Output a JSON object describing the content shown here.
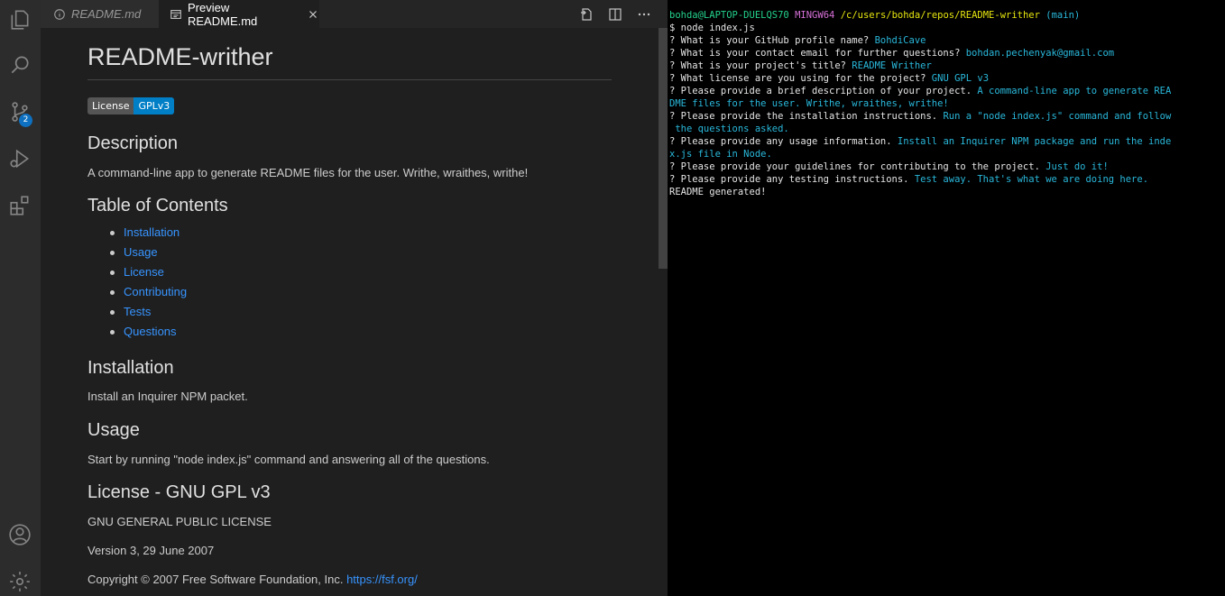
{
  "tabs": [
    {
      "label": "README.md"
    },
    {
      "label": "Preview README.md"
    }
  ],
  "scm_badge": "2",
  "preview": {
    "title": "README-writher",
    "badge": {
      "left": "License",
      "right": "GPLv3"
    },
    "description_heading": "Description",
    "description_text": "A command-line app to generate README files for the user. Writhe, wraithes, writhe!",
    "toc_heading": "Table of Contents",
    "toc": [
      "Installation",
      "Usage",
      "License",
      "Contributing",
      "Tests",
      "Questions"
    ],
    "installation_heading": "Installation",
    "installation_text": "Install an Inquirer NPM packet.",
    "usage_heading": "Usage",
    "usage_text": "Start by running \"node index.js\" command and answering all of the questions.",
    "license_heading": "License - GNU GPL v3",
    "license_line1": "GNU GENERAL PUBLIC LICENSE",
    "license_line2": "Version 3, 29 June 2007",
    "copyright_text": "Copyright © 2007 Free Software Foundation, Inc. ",
    "copyright_link": "https://fsf.org/"
  },
  "terminal": {
    "prompt_user": "bohda@LAPTOP-DUELQS70",
    "prompt_env": "MINGW64",
    "prompt_path": "/c/users/bohda/repos/README-writher",
    "prompt_branch": "(main)",
    "command": "$ node index.js",
    "qa": [
      {
        "q": "? What is your GitHub profile name? ",
        "a": "BohdiCave"
      },
      {
        "q": "? What is your contact email for further questions? ",
        "a": "bohdan.pechenyak@gmail.com"
      },
      {
        "q": "? What is your project's title? ",
        "a": "README Writher"
      },
      {
        "q": "? What license are you using for the project? ",
        "a": "GNU GPL v3"
      },
      {
        "q": "? Please provide a brief description of your project. ",
        "a": "A command-line app to generate REA"
      },
      {
        "q": "",
        "a": "DME files for the user. Writhe, wraithes, writhe!"
      },
      {
        "q": "? Please provide the installation instructions. ",
        "a": "Run a \"node index.js\" command and follow"
      },
      {
        "q": "",
        "a": " the questions asked."
      },
      {
        "q": "? Please provide any usage information. ",
        "a": "Install an Inquirer NPM package and run the inde"
      },
      {
        "q": "",
        "a": "x.js file in Node."
      },
      {
        "q": "? Please provide your guidelines for contributing to the project. ",
        "a": "Just do it!"
      },
      {
        "q": "? Please provide any testing instructions. ",
        "a": "Test away. That's what we are doing here."
      }
    ],
    "result": "README generated!"
  }
}
